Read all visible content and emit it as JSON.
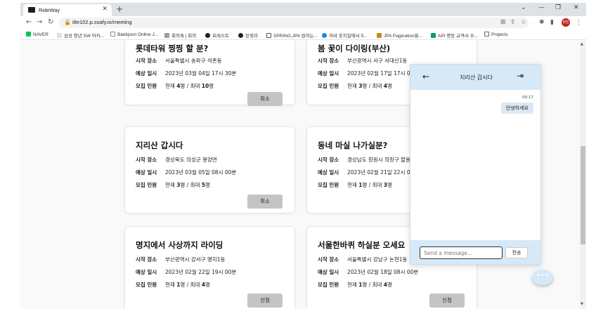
{
  "browser": {
    "tab_title": "RideWay",
    "tab_close": "✕",
    "new_tab": "+",
    "url": "i8e102.p.ssafy.io/meeting",
    "avatar_text": "희진"
  },
  "bookmarks": [
    {
      "label": "NAVER",
      "color": "#03c75a"
    },
    {
      "label": "삼성 청년 SW 아카...",
      "color": "#e2e2e2"
    },
    {
      "label": "Baekjoon Online J...",
      "color": "#ffffff"
    },
    {
      "label": "회의록 | 회의",
      "color": "#9e9e9e"
    },
    {
      "label": "프레스트",
      "color": "#222222"
    },
    {
      "label": "린윗미",
      "color": "#222222"
    },
    {
      "label": "SPRING,JPA 원하는...",
      "color": "#ffffff"
    },
    {
      "label": "자바 웅지알에서 5...",
      "color": "#1e88e5"
    },
    {
      "label": "JPA Pagination을...",
      "color": "#c58b1e"
    },
    {
      "label": "API 명동 규격서 수...",
      "color": "#0f9d58"
    },
    {
      "label": "Projects",
      "color": "#ffffff"
    }
  ],
  "labels": {
    "start": "시작 장소",
    "date": "예상 일시",
    "people": "모집 인원"
  },
  "cards": [
    {
      "title": "롯데타워 찡찡 할 분?",
      "start": "서울특별시 송파구 석촌동",
      "date": "2023년 03월 04일 17시 30분",
      "people_now": "현재 ",
      "people_now_n": "4",
      "people_mid": "명 / 최대 ",
      "people_max_n": "10",
      "people_end": "명",
      "button": "취소"
    },
    {
      "title": "봄 꽃이 다이링(부산)",
      "start": "부산광역시 서구 서대신1동",
      "date": "2023년 02월 17일 17시 00분",
      "people_now": "현재 ",
      "people_now_n": "3",
      "people_mid": "명 / 최대 ",
      "people_max_n": "4",
      "people_end": "명",
      "button": ""
    },
    {
      "title": "지리산 갑시다",
      "start": "경상북도 의성군 봉양면",
      "date": "2023년 03월 05일 08시 00분",
      "people_now": "현재 ",
      "people_now_n": "3",
      "people_mid": "명 / 최대 ",
      "people_max_n": "5",
      "people_end": "명",
      "button": "취소"
    },
    {
      "title": "동네 마실 나가실분?",
      "start": "경상남도 창원시 의창구 팔용",
      "date": "2023년 02월 21일 22시 00분",
      "people_now": "현재 ",
      "people_now_n": "1",
      "people_mid": "명 / 최대 ",
      "people_max_n": "3",
      "people_end": "명",
      "button": ""
    },
    {
      "title": "명지에서 사상까지 라이딩",
      "start": "부산광역시 강서구 명지1동",
      "date": "2023년 02월 22일 19시 00분",
      "people_now": "현재 ",
      "people_now_n": "1",
      "people_mid": "명 / 최대 ",
      "people_max_n": "4",
      "people_end": "명",
      "button": "신청"
    },
    {
      "title": "서울한바퀴 하실분 오세요",
      "start": "서울특별시 강남구 논현1동",
      "date": "2023년 02월 18일 08시 00분",
      "people_now": "현재 ",
      "people_now_n": "1",
      "people_mid": "명 / 최대 ",
      "people_max_n": "4",
      "people_end": "명",
      "button": "신청"
    }
  ],
  "chat": {
    "title": "지리산 갑시다",
    "time": "00:17",
    "message": "안녕하세요",
    "placeholder": "Send a message...",
    "send_label": "전송"
  },
  "fab_label": "•••",
  "colors": {
    "chat_header": "#d6e9f8",
    "button_gray": "#c4c4c4",
    "page_bg": "#f9f9f9"
  }
}
